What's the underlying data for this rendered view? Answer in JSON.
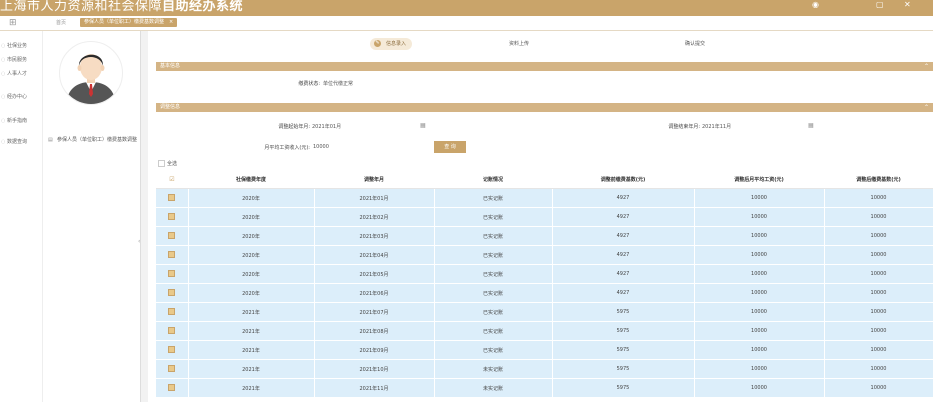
{
  "app": {
    "title_regular": "上海市人力资源和社会保障",
    "title_bold": "自助经办系统"
  },
  "tabs": {
    "home": "首页",
    "active": "参保人员（单位职工）缴费基数调整",
    "close": "×"
  },
  "leftnav": {
    "items": [
      {
        "label": "社保业务"
      },
      {
        "label": "市民服务"
      },
      {
        "label": "人事人才"
      },
      {
        "label": "经办中心"
      },
      {
        "label": "新手指南"
      },
      {
        "label": "数据查询"
      }
    ]
  },
  "profile": {
    "menu_label": "参保人员（单位职工）缴费基数调整"
  },
  "steps": [
    {
      "label": "信息录入"
    },
    {
      "label": "资料上传"
    },
    {
      "label": "确认提交"
    }
  ],
  "section_basic": {
    "title": "基本信息",
    "status_label": "缴费状态:",
    "status_value": "单位代缴正常"
  },
  "section_adjust": {
    "title": "调整信息",
    "start_label": "调整起始年月:",
    "start_value": "2021年01月",
    "end_label": "调整结束年月:",
    "end_value": "2021年11月",
    "wage_label": "月平均工资收入(元):",
    "wage_value": "10000",
    "query_button": "查 询"
  },
  "table": {
    "select_all_label": "全选",
    "columns": [
      "社保缴费年度",
      "调整年月",
      "记账情况",
      "调整前缴费基数(元)",
      "调整后月平均工资(元)",
      "调整后缴费基数(元)"
    ],
    "rows": [
      [
        "2020年",
        "2021年01月",
        "已实记账",
        "4927",
        "10000",
        "10000"
      ],
      [
        "2020年",
        "2021年02月",
        "已实记账",
        "4927",
        "10000",
        "10000"
      ],
      [
        "2020年",
        "2021年03月",
        "已实记账",
        "4927",
        "10000",
        "10000"
      ],
      [
        "2020年",
        "2021年04月",
        "已实记账",
        "4927",
        "10000",
        "10000"
      ],
      [
        "2020年",
        "2021年05月",
        "已实记账",
        "4927",
        "10000",
        "10000"
      ],
      [
        "2020年",
        "2021年06月",
        "已实记账",
        "4927",
        "10000",
        "10000"
      ],
      [
        "2021年",
        "2021年07月",
        "已实记账",
        "5975",
        "10000",
        "10000"
      ],
      [
        "2021年",
        "2021年08月",
        "已实记账",
        "5975",
        "10000",
        "10000"
      ],
      [
        "2021年",
        "2021年09月",
        "已实记账",
        "5975",
        "10000",
        "10000"
      ],
      [
        "2021年",
        "2021年10月",
        "未实记账",
        "5975",
        "10000",
        "10000"
      ],
      [
        "2021年",
        "2021年11月",
        "未实记账",
        "5975",
        "10000",
        "10000"
      ]
    ]
  },
  "colors": {
    "brand": "#c9a46a",
    "section_bar": "#d4b485",
    "row_bg": "#dceefa"
  }
}
